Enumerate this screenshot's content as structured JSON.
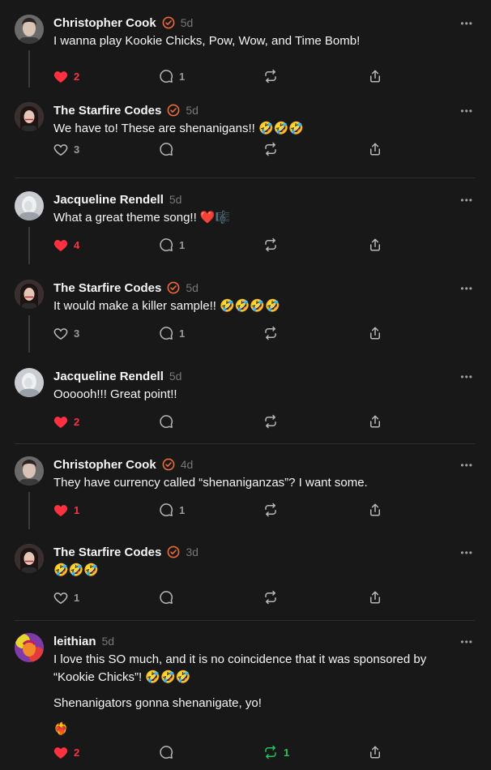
{
  "colors": {
    "background": "#181818",
    "accent_verified": "#f06a35",
    "like_active": "#ff3040",
    "repost_active": "#22c55e",
    "muted": "#777777"
  },
  "posts": [
    {
      "author": "Christopher Cook",
      "verified": true,
      "time": "5d",
      "text": [
        "I wanna play Kookie Chicks, Pow, Wow, and Time Bomb!"
      ],
      "likes": "2",
      "liked": true,
      "replies": "1",
      "reposts": "",
      "reposted": false,
      "avatar": "person-avatar-dark-hair"
    },
    {
      "author": "The Starfire Codes",
      "verified": true,
      "time": "5d",
      "text": [
        "We have to! These are shenanigans!! 🤣🤣🤣"
      ],
      "likes": "3",
      "liked": false,
      "replies": "",
      "reposts": "",
      "reposted": false,
      "avatar": "person-avatar-long-hair"
    },
    {
      "author": "Jacqueline Rendell",
      "verified": false,
      "time": "5d",
      "text": [
        "What a great theme song!! ❤️🎼"
      ],
      "likes": "4",
      "liked": true,
      "replies": "1",
      "reposts": "",
      "reposted": false,
      "avatar": "person-avatar-light"
    },
    {
      "author": "The Starfire Codes",
      "verified": true,
      "time": "5d",
      "text": [
        "It would make a killer sample!! 🤣🤣🤣🤣"
      ],
      "likes": "3",
      "liked": false,
      "replies": "1",
      "reposts": "",
      "reposted": false,
      "avatar": "person-avatar-long-hair"
    },
    {
      "author": "Jacqueline Rendell",
      "verified": false,
      "time": "5d",
      "text": [
        "Oooooh!!! Great point!!"
      ],
      "likes": "2",
      "liked": true,
      "replies": "",
      "reposts": "",
      "reposted": false,
      "avatar": "person-avatar-light"
    },
    {
      "author": "Christopher Cook",
      "verified": true,
      "time": "4d",
      "text": [
        "They have currency called “shenaniganzas”? I want some."
      ],
      "likes": "1",
      "liked": true,
      "replies": "1",
      "reposts": "",
      "reposted": false,
      "avatar": "person-avatar-dark-hair"
    },
    {
      "author": "The Starfire Codes",
      "verified": true,
      "time": "3d",
      "text": [
        "🤣🤣🤣"
      ],
      "likes": "1",
      "liked": false,
      "replies": "",
      "reposts": "",
      "reposted": false,
      "avatar": "person-avatar-long-hair"
    },
    {
      "author": "leithian",
      "verified": false,
      "time": "5d",
      "text": [
        "I love this SO much, and it is no coincidence that it was sponsored by “Kookie Chicks”! 🤣🤣🤣",
        "Shenanigators gonna shenanigate, yo!",
        "❤️‍🔥"
      ],
      "likes": "2",
      "liked": true,
      "replies": "",
      "reposts": "1",
      "reposted": true,
      "avatar": "person-avatar-colorful"
    }
  ]
}
